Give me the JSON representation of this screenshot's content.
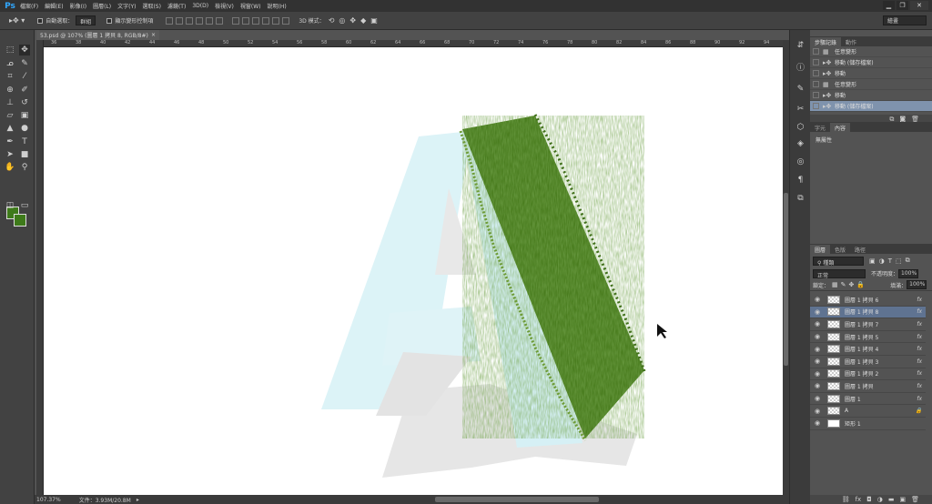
{
  "app": {
    "logo": "Ps",
    "minimize": "▁",
    "restore": "❐",
    "close": "✕"
  },
  "menu": [
    "檔案(F)",
    "編輯(E)",
    "影像(I)",
    "圖層(L)",
    "文字(Y)",
    "選取(S)",
    "濾鏡(T)",
    "3D(D)",
    "檢視(V)",
    "視窗(W)",
    "說明(H)"
  ],
  "options": {
    "auto_select_label": "自動選取：",
    "auto_select_value": "群組",
    "transform_controls_label": "顯示變形控制項",
    "mode_3d_label": "3D 模式：",
    "workspace": "繪畫"
  },
  "document": {
    "tab_title": "53.psd @ 107% (圖層 1 拷貝 8, RGB/8#)",
    "close": "×"
  },
  "ruler": {
    "h_ticks": [
      "36",
      "38",
      "40",
      "42",
      "44",
      "46",
      "48",
      "50",
      "52",
      "54",
      "56",
      "58",
      "60",
      "62",
      "64",
      "66",
      "68",
      "70",
      "72",
      "74",
      "76",
      "78",
      "80",
      "82",
      "84",
      "86",
      "88",
      "90",
      "92",
      "94"
    ]
  },
  "status": {
    "zoom": "107.37%",
    "doc_size": "文件：3.93M/20.8M"
  },
  "colors": {
    "foreground": "#3e7a1a",
    "background": "#3e7a1a",
    "accent_selected": "#7f93ad"
  },
  "history": {
    "tabs": [
      "步驟記錄",
      "動作"
    ],
    "items": [
      {
        "label": "任意變形",
        "icon": "transform-icon",
        "selected": false
      },
      {
        "label": "移動 (儲存檔案)",
        "icon": "move-icon",
        "selected": false
      },
      {
        "label": "移動",
        "icon": "move-icon",
        "selected": false
      },
      {
        "label": "任意變形",
        "icon": "transform-icon",
        "selected": false
      },
      {
        "label": "移動",
        "icon": "move-icon",
        "selected": false
      },
      {
        "label": "移動 (儲存檔案)",
        "icon": "move-icon",
        "selected": true
      }
    ]
  },
  "properties": {
    "tabs": [
      "字元",
      "內容"
    ],
    "body": "無屬性"
  },
  "layers": {
    "tabs": [
      "圖層",
      "色版",
      "路徑"
    ],
    "filter": "種類",
    "blend_mode": "正常",
    "opacity_label": "不透明度：",
    "opacity_value": "100%",
    "lock_label": "鎖定：",
    "fill_label": "填滿：",
    "fill_value": "100%",
    "items": [
      {
        "name": "圖層 1 拷貝 6",
        "fx": true,
        "selected": false
      },
      {
        "name": "圖層 1 拷貝 8",
        "fx": true,
        "selected": true
      },
      {
        "name": "圖層 1 拷貝 7",
        "fx": true,
        "selected": false
      },
      {
        "name": "圖層 1 拷貝 5",
        "fx": true,
        "selected": false
      },
      {
        "name": "圖層 1 拷貝 4",
        "fx": true,
        "selected": false
      },
      {
        "name": "圖層 1 拷貝 3",
        "fx": true,
        "selected": false
      },
      {
        "name": "圖層 1 拷貝 2",
        "fx": true,
        "selected": false
      },
      {
        "name": "圖層 1 拷貝",
        "fx": true,
        "selected": false
      },
      {
        "name": "圖層 1",
        "fx": true,
        "selected": false
      },
      {
        "name": "A",
        "fx": false,
        "locked": true,
        "selected": false
      },
      {
        "name": "矩形 1",
        "fx": false,
        "selected": false
      }
    ]
  }
}
